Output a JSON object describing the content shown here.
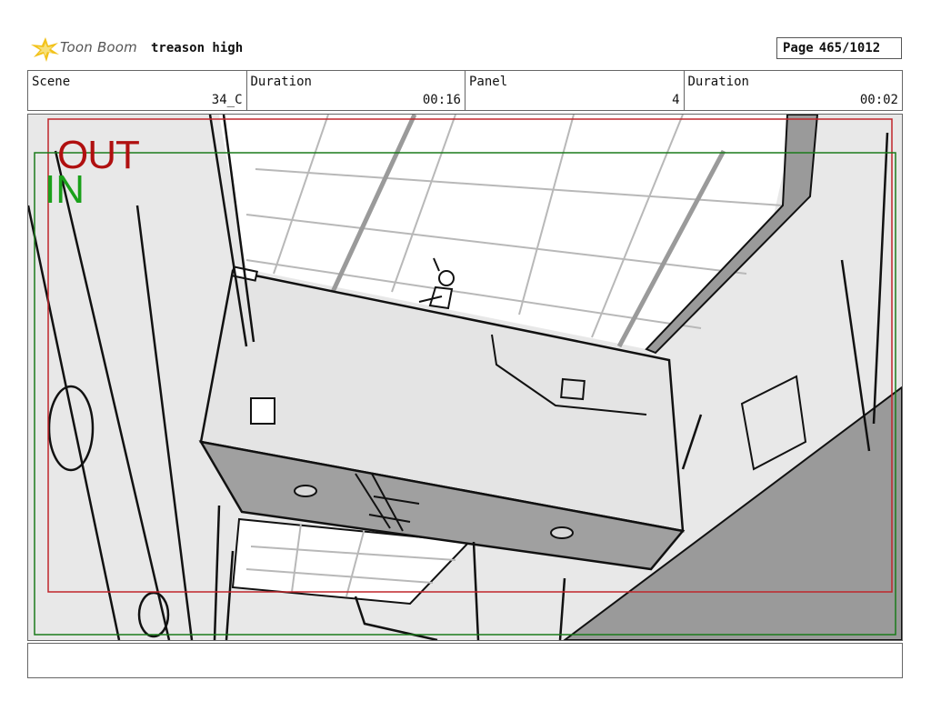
{
  "header": {
    "logo_text": "Toon Boom",
    "project_title": "treason high",
    "page_label": "Page",
    "page_value": "465/1012"
  },
  "info": {
    "scene_label": "Scene",
    "scene_value": "34_C",
    "scene_duration_label": "Duration",
    "scene_duration_value": "00:16",
    "panel_label": "Panel",
    "panel_value": "4",
    "panel_duration_label": "Duration",
    "panel_duration_value": "00:02"
  },
  "panel": {
    "out_label": "OUT",
    "in_label": "IN",
    "out_color": "#b01010",
    "in_color": "#1aa01a"
  },
  "notes": {
    "text": ""
  }
}
